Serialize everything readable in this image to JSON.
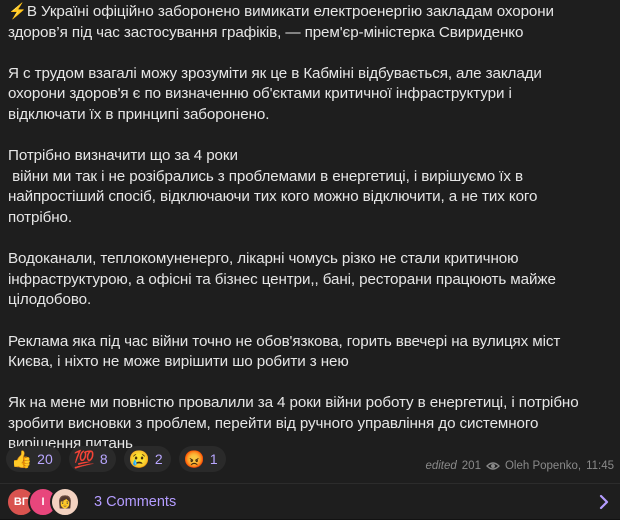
{
  "post": {
    "paragraphs": [
      {
        "lead_icon": "⚡",
        "lines": [
          "В Україні офіційно заборонено вимикати електроенергію закладам охорони",
          "здоров’я під час застосування графіків, — прем'єр-міністерка Свириденко"
        ]
      },
      {
        "lines": [
          "Я с трудом взагалі можу зрозуміти як це в Кабміні відбувається, але заклади",
          "охорони здоров'я є по визначенню об'єктами критичної інфраструктури і",
          "відключати їх в принципі заборонено."
        ]
      },
      {
        "lines": [
          "Потрібно визначити що за 4 роки",
          " війни ми так і не розібрались з проблемами в енергетиці, і вирішуємо їх в",
          "найпростіший спосіб, відключаючи тих кого можно відключити, а не тих кого",
          "потрібно."
        ]
      },
      {
        "lines": [
          "Водоканали, теплокомуненерго, лікарні чомусь різко не стали критичною",
          "інфраструктурою, а офісні та бізнес центри,, бані, ресторани працюють майже",
          "цілодобово."
        ]
      },
      {
        "lines": [
          "Реклама яка під час війни точно не обов'язкова, горить ввечері на вулицях міст",
          "Києва, і ніхто не може вирішити шо робити з нею"
        ]
      },
      {
        "lines": [
          "Як на мене ми повністю провалили за 4 роки війни роботу в енергетиці, і потрібно",
          "зробити висновки з проблем, перейти від ручного управління до системного",
          "вирішення питань"
        ]
      }
    ]
  },
  "reactions": [
    {
      "emoji": "👍",
      "icon": "thumbs-up-icon",
      "count": "20"
    },
    {
      "emoji": "💯",
      "icon": "hundred-points-icon",
      "count": "8"
    },
    {
      "emoji": "😢",
      "icon": "crying-face-icon",
      "count": "2"
    },
    {
      "emoji": "😡",
      "icon": "angry-face-icon",
      "count": "1"
    }
  ],
  "meta": {
    "edited": "edited",
    "views": "201",
    "author": "Oleh Popenko",
    "time": "11:45"
  },
  "comments": {
    "avatars": [
      {
        "initials": "ВГ",
        "color": "#d9534f"
      },
      {
        "initials": "І",
        "color": "#e8467c"
      },
      {
        "initials": "👩",
        "color": "#f3d2c1"
      }
    ],
    "label": "3 Comments"
  },
  "colors": {
    "background": "#1e1e1e",
    "text": "#e6e6e6",
    "accent": "#b49cff",
    "meta": "#8a8a8a"
  }
}
